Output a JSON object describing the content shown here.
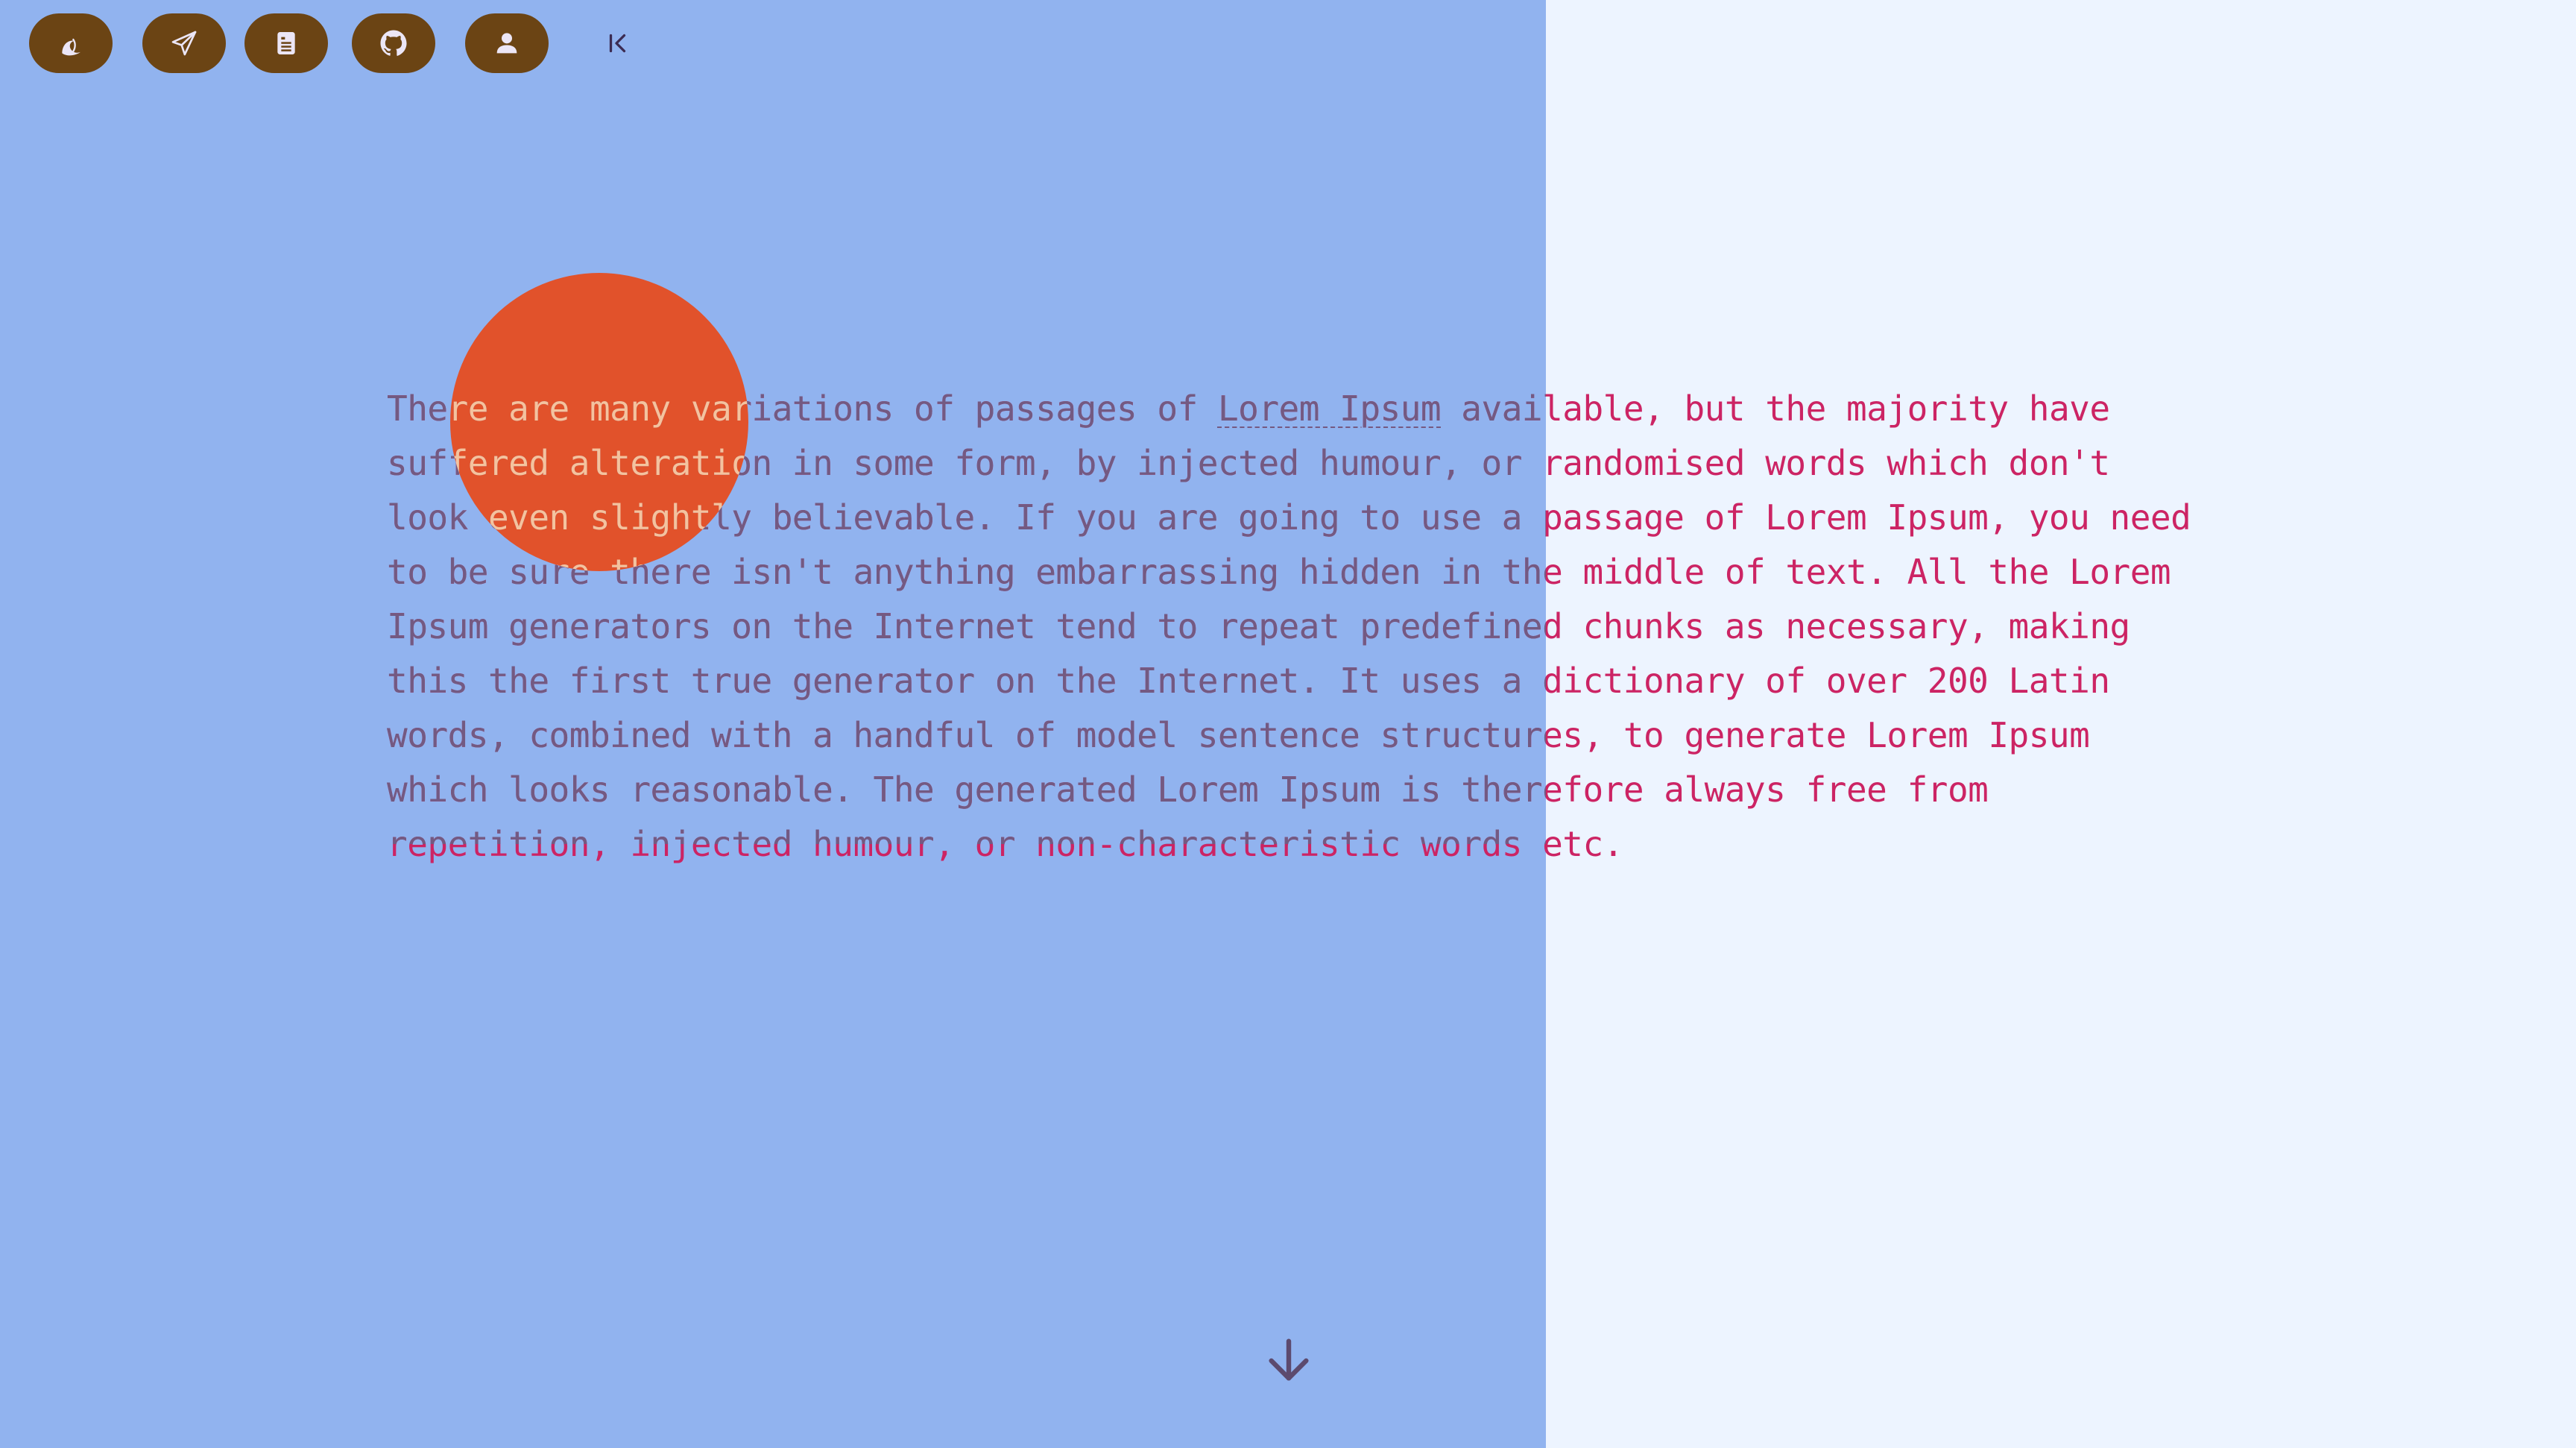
{
  "toolbar": {
    "buttons": [
      {
        "icon": "moon-icon"
      },
      {
        "icon": "paper-plane-icon"
      },
      {
        "icon": "document-icon"
      },
      {
        "icon": "github-icon"
      },
      {
        "icon": "user-icon"
      }
    ],
    "collapse_icon": "collapse-left-icon"
  },
  "content": {
    "pre_link": "There are many variations of passages of ",
    "link_text": "Lorem Ipsum",
    "post_link": " available, but the majority have suffered alteration in some form, by injected humour, or randomised words which don't look even slightly believable. If you are going to use a passage of Lorem Ipsum, you need to be sure there isn't anything embarrassing hidden in the middle of text. All the Lorem Ipsum generators on the Internet tend to repeat predefined chunks as necessary, making this the first true generator on the Internet. It uses a dictionary of over 200 Latin words, combined with a handful of model sentence structures, to generate Lorem Ipsum which looks reasonable. The generated Lorem Ipsum is therefore always free from repetition, injected humour, or non-characteristic words etc."
  },
  "scroll_icon": "arrow-down-icon",
  "colors": {
    "left_panel": "#91b3ef",
    "right_panel": "#edf4ff",
    "toolbar_button": "#6b4414",
    "blob": "#e1522b",
    "text_on_left": "#735a82",
    "text_on_right": "#cc2464",
    "text_on_blob": "#f4c39e"
  }
}
